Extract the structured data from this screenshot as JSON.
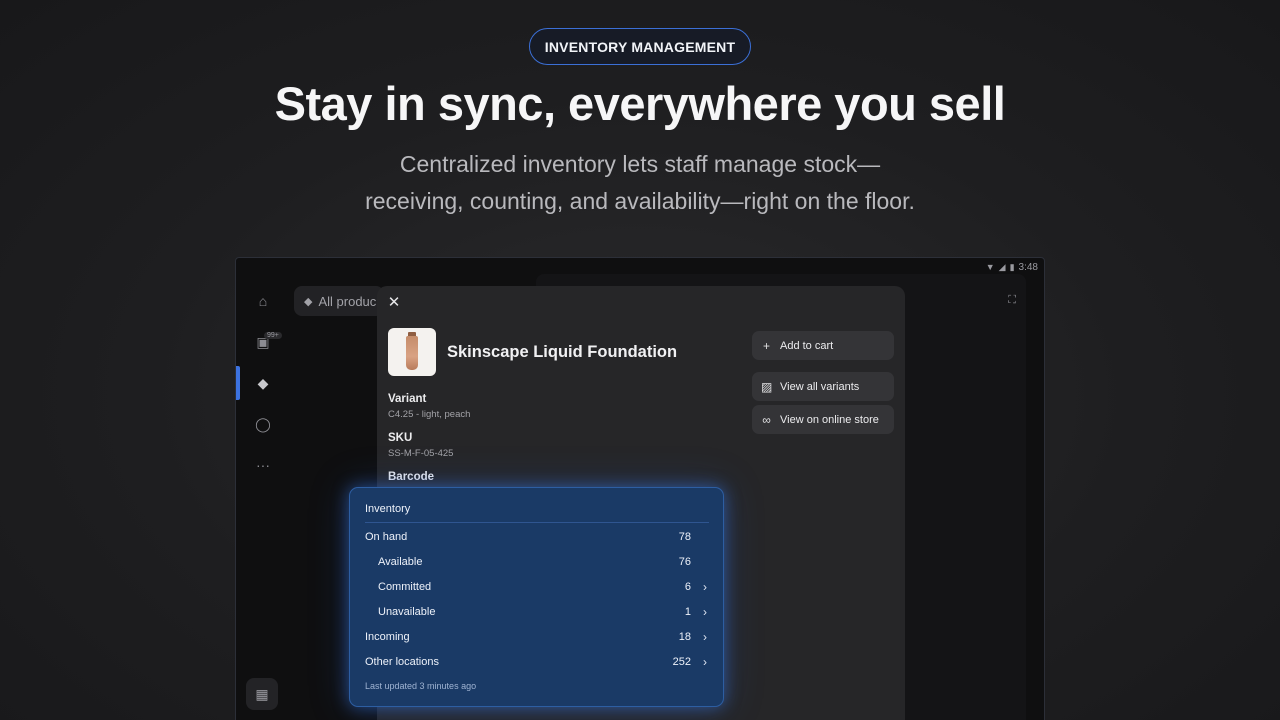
{
  "hero": {
    "pill": "INVENTORY MANAGEMENT",
    "title": "Stay in sync, everywhere you sell",
    "subtitle_line1": "Centralized inventory lets staff manage stock—",
    "subtitle_line2": "receiving, counting, and availability—right on the floor."
  },
  "status_bar": {
    "time": "3:48"
  },
  "sidebar": {
    "badge": "99+"
  },
  "search": {
    "label": "All produc"
  },
  "product": {
    "title": "Skinscape Liquid Foundation",
    "variant_label": "Variant",
    "variant_value": "C4.25 - light, peach",
    "sku_label": "SKU",
    "sku_value": "SS-M-F-05-425",
    "barcode_label": "Barcode"
  },
  "actions": {
    "add_to_cart": "Add to cart",
    "view_all_variants": "View all variants",
    "view_online_store": "View on online store"
  },
  "inventory": {
    "heading": "Inventory",
    "rows": [
      {
        "label": "On hand",
        "value": "78"
      },
      {
        "label": "Available",
        "value": "76"
      },
      {
        "label": "Committed",
        "value": "6"
      },
      {
        "label": "Unavailable",
        "value": "1"
      },
      {
        "label": "Incoming",
        "value": "18"
      },
      {
        "label": "Other locations",
        "value": "252"
      }
    ],
    "footer": "Last updated 3 minutes ago"
  },
  "colors": {
    "accent": "#3c72e0",
    "inventory_card": "#1a3a66",
    "modal": "#262628"
  }
}
